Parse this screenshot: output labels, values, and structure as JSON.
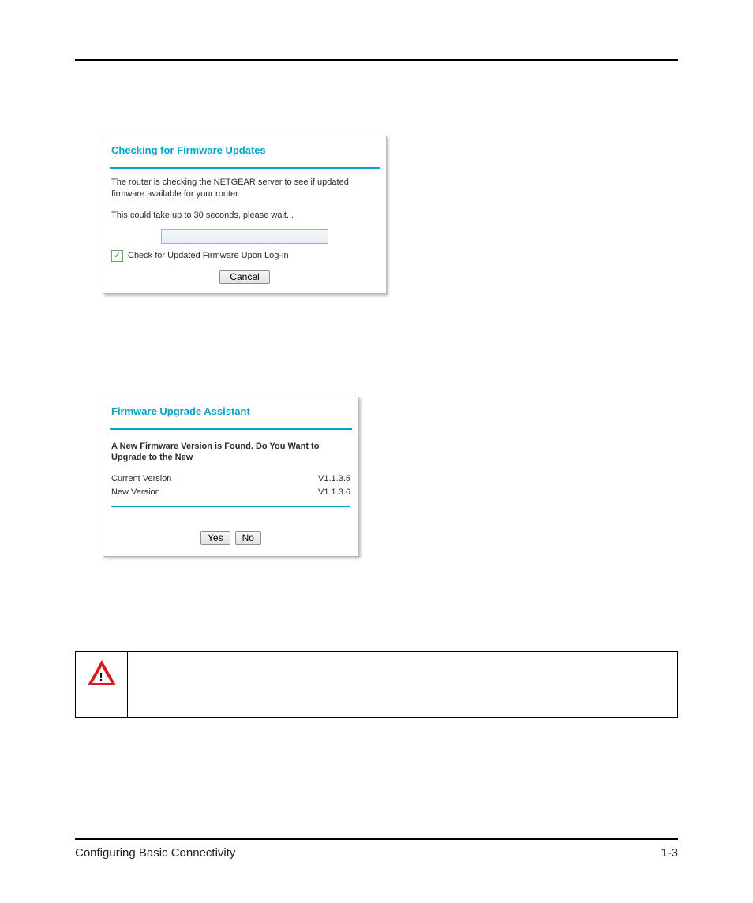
{
  "panel1": {
    "title": "Checking for Firmware Updates",
    "body_line1": "The router is checking the NETGEAR server to see if updated firmware available for your router.",
    "body_line2": "This could take up to 30 seconds, please wait...",
    "checkbox_label": "Check for Updated Firmware Upon Log-in",
    "check_glyph": "✓",
    "cancel": "Cancel"
  },
  "panel2": {
    "title": "Firmware Upgrade Assistant",
    "prompt": "A New Firmware Version is Found. Do You Want to Upgrade to the New",
    "current_label": "Current Version",
    "current_value": "V1.1.3.5",
    "new_label": "New Version",
    "new_value": "V1.1.3.6",
    "yes": "Yes",
    "no": "No"
  },
  "warning": {
    "bang": "!"
  },
  "footer": {
    "section": "Configuring Basic Connectivity",
    "page": "1-3"
  }
}
